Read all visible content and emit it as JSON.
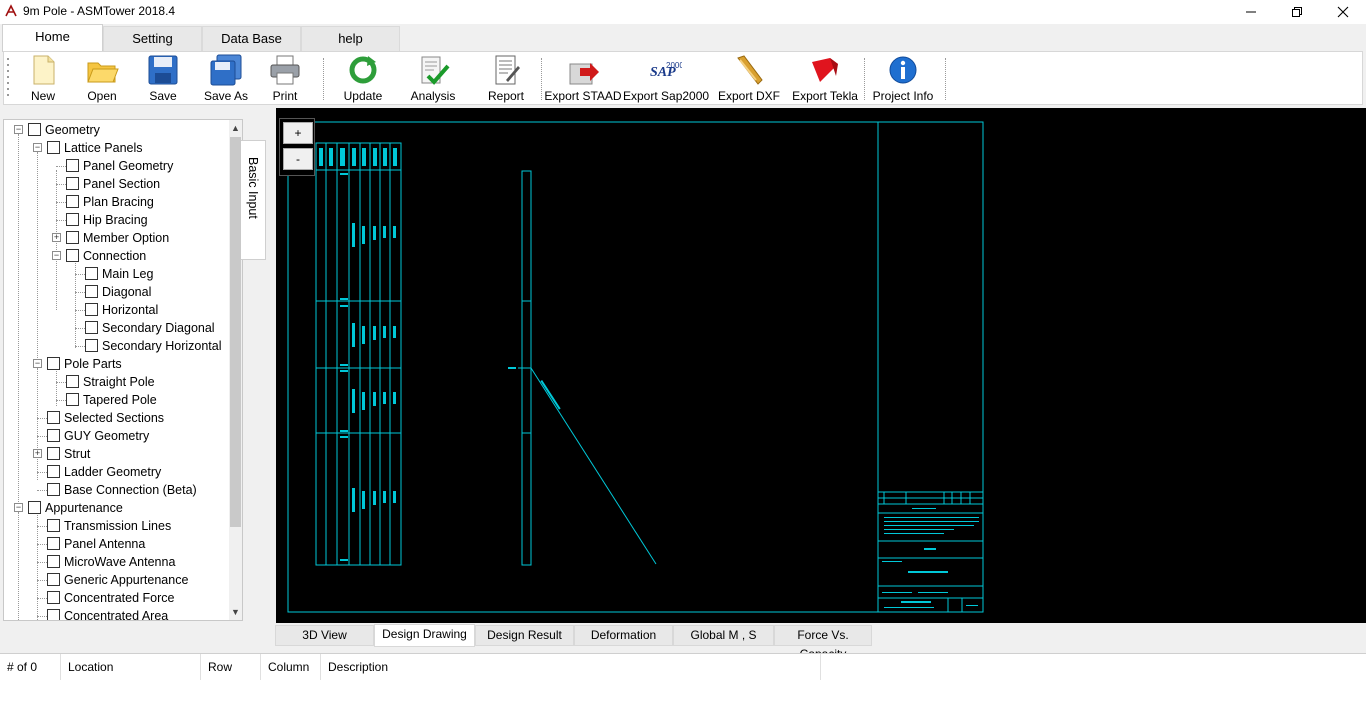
{
  "window": {
    "title": "9m Pole - ASMTower 2018.4",
    "icon": "app-logo-icon",
    "controls": [
      "minimize-icon",
      "restore-icon",
      "close-icon"
    ]
  },
  "ribbon_tabs": [
    {
      "label": "Home",
      "active": true
    },
    {
      "label": "Setting",
      "active": false
    },
    {
      "label": "Data Base",
      "active": false
    },
    {
      "label": "help",
      "active": false
    }
  ],
  "toolbar": {
    "new": "New",
    "open": "Open",
    "save": "Save",
    "save_as": "Save As",
    "print": "Print",
    "update": "Update",
    "analysis": "Analysis",
    "report": "Report",
    "export_staad": "Export STAAD",
    "export_sap2000": "Export Sap2000",
    "export_dxf": "Export DXF",
    "export_tekla": "Export Tekla",
    "project_info": "Project Info"
  },
  "tree": {
    "geometry": "Geometry",
    "lattice_panels": "Lattice Panels",
    "panel_geometry": "Panel Geometry",
    "panel_section": "Panel Section",
    "plan_bracing": "Plan Bracing",
    "hip_bracing": "Hip Bracing",
    "member_option": "Member Option",
    "connection": "Connection",
    "main_leg": "Main Leg",
    "diagonal": "Diagonal",
    "horizontal": "Horizontal",
    "secondary_diagonal": "Secondary Diagonal",
    "secondary_horizontal": "Secondary Horizontal",
    "pole_parts": "Pole Parts",
    "straight_pole": "Straight Pole",
    "tapered_pole": "Tapered Pole",
    "selected_sections": "Selected Sections",
    "guy_geometry": "GUY Geometry",
    "strut": "Strut",
    "ladder_geometry": "Ladder Geometry",
    "base_connection": "Base Connection (Beta)",
    "appurtenance": "Appurtenance",
    "transmission_lines": "Transmission Lines",
    "panel_antenna": "Panel Antenna",
    "microwave_antenna": "MicroWave Antenna",
    "generic_appurtenance": "Generic Appurtenance",
    "concentrated_force": "Concentrated Force",
    "concentrated_area": "Concentrated Area"
  },
  "side_tab": "Basic Input",
  "zoom": {
    "in": "+",
    "out": "-"
  },
  "bottom_tabs": [
    {
      "label": "3D View",
      "active": false
    },
    {
      "label": "Design Drawing",
      "active": true
    },
    {
      "label": "Design Result",
      "active": false
    },
    {
      "label": "Deformation",
      "active": false
    },
    {
      "label": "Global M , S",
      "active": false
    },
    {
      "label": "Force Vs. Capacity",
      "active": false
    }
  ],
  "message_grid": {
    "columns": [
      "# of 0",
      "Location",
      "Row",
      "Column",
      "Description"
    ]
  },
  "colors": {
    "drawing_bg": "#000000",
    "drawing_line": "#00c8d8",
    "ribbon_bg": "#ffffff",
    "window_bg": "#f0f0f0"
  }
}
